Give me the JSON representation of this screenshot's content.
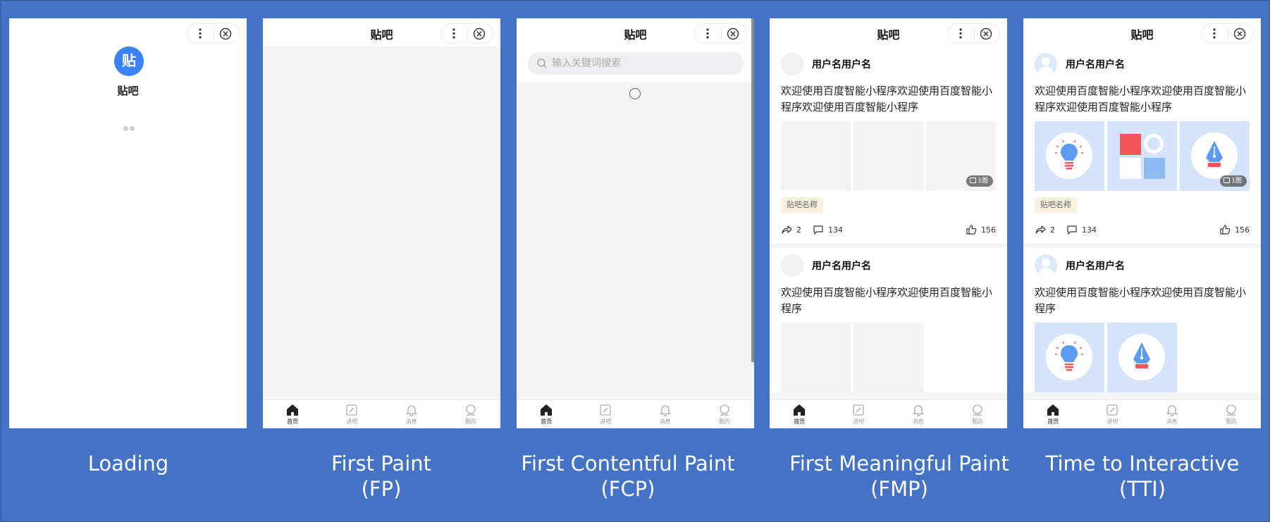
{
  "app": {
    "title": "贴吧",
    "logo_char": "贴",
    "search_placeholder": "输入关键词搜索"
  },
  "tabs": [
    {
      "label": "首页",
      "icon": "home-icon"
    },
    {
      "label": "进吧",
      "icon": "edit-icon"
    },
    {
      "label": "消息",
      "icon": "bell-icon"
    },
    {
      "label": "我的",
      "icon": "user-icon"
    }
  ],
  "stages": [
    {
      "caption_line1": "Loading",
      "caption_line2": ""
    },
    {
      "caption_line1": "First Paint",
      "caption_line2": "(FP)"
    },
    {
      "caption_line1": "First Contentful Paint",
      "caption_line2": "(FCP)"
    },
    {
      "caption_line1": "First Meaningful Paint",
      "caption_line2": "(FMP)"
    },
    {
      "caption_line1": "Time to Interactive",
      "caption_line2": "(TTI)"
    }
  ],
  "posts": [
    {
      "username": "用户名用户名",
      "text": "欢迎使用百度智能小程序欢迎使用百度智能小程序欢迎使用百度智能小程序",
      "image_badge": "1图",
      "bar_name": "贴吧名称",
      "shares": "2",
      "comments": "134",
      "likes": "156"
    },
    {
      "username": "用户名用户名",
      "text": "欢迎使用百度智能小程序欢迎使用百度智能小程序"
    }
  ],
  "colors": {
    "background": "#4472c4",
    "logo": "#3b82f6",
    "image_tile": "#d4e4fb",
    "accent_red": "#f4565a",
    "accent_blue": "#5b9cf0"
  }
}
